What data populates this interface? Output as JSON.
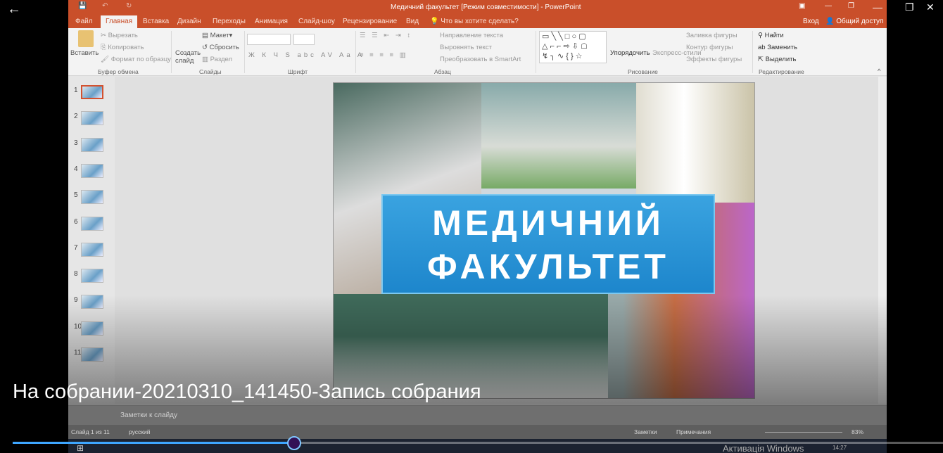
{
  "window": {
    "title": "Медичний факультет [Режим совместимости] - PowerPoint"
  },
  "tabs": [
    "Файл",
    "Главная",
    "Вставка",
    "Дизайн",
    "Переходы",
    "Анимация",
    "Слайд-шоу",
    "Рецензирование",
    "Вид"
  ],
  "tell_me": "Что вы хотите сделать?",
  "signin": "Вход",
  "share": "Общий доступ",
  "ribbon": {
    "paste": "Вставить",
    "cut": "Вырезать",
    "copy": "Копировать",
    "format_painter": "Формат по образцу",
    "clipboard": "Буфер обмена",
    "new_slide": "Создать слайд",
    "layout": "Макет",
    "reset": "Сбросить",
    "section": "Раздел",
    "slides": "Слайды",
    "font": "Шрифт",
    "paragraph": "Абзац",
    "text_direction": "Направление текста",
    "align_text": "Выровнять текст",
    "smartart": "Преобразовать в SmartArt",
    "arrange": "Упорядочить",
    "quick_styles": "Экспресс-стили",
    "shape_fill": "Заливка фигуры",
    "shape_outline": "Контур фигуры",
    "shape_effects": "Эффекты фигуры",
    "drawing": "Рисование",
    "find": "Найти",
    "replace": "Заменить",
    "select": "Выделить",
    "editing": "Редактирование"
  },
  "slides": [
    "1",
    "2",
    "3",
    "4",
    "5",
    "6",
    "7",
    "8",
    "9",
    "10",
    "11"
  ],
  "slide": {
    "line1": "МЕДИЧНИЙ",
    "line2": "ФАКУЛЬТЕТ"
  },
  "notes": "Заметки к слайду",
  "status": {
    "slide": "Слайд 1 из 11",
    "lang": "русский",
    "notes": "Заметки",
    "comments": "Примечания",
    "zoom": "83%"
  },
  "video": {
    "title": "На собрании-20210310_141450-Запись собрания",
    "progress_fraction": 0.31
  },
  "watermark": "Активація Windows",
  "clock": "14:27"
}
